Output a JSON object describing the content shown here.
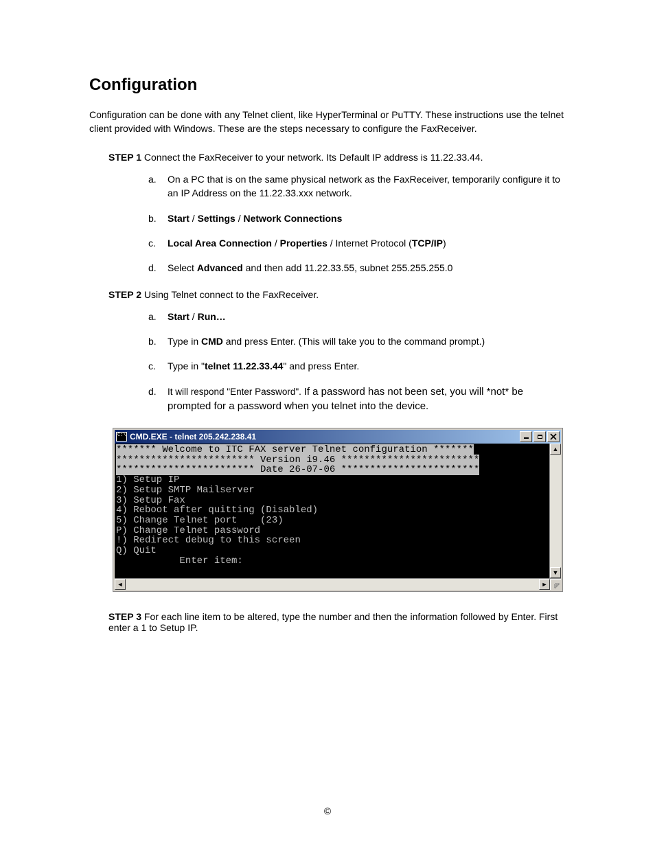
{
  "title": "Configuration",
  "intro": "Configuration can be done with any Telnet client, like HyperTerminal or PuTTY. These instructions use the telnet client provided with Windows. These are the steps necessary to configure the FaxReceiver.",
  "steps": {
    "s1": {
      "label": "STEP 1",
      "text": " Connect the FaxReceiver to your network. Its Default IP address is 11.22.33.44.",
      "a": "On a PC that is on the same physical network as the FaxReceiver, temporarily configure it to an IP Address on the 11.22.33.xxx network.",
      "b_parts": {
        "start": "Start",
        "sep1": " / ",
        "settings": "Settings",
        "sep2": " / ",
        "net": "Network Connections"
      },
      "c_parts": {
        "lac": "Local Area Connection",
        "sep1": " / ",
        "prop": "Properties",
        "sep2": " / Internet Protocol (",
        "tcp": "TCP/IP",
        "end": ")"
      },
      "d_parts": {
        "pre": "Select ",
        "adv": "Advanced",
        "post": " and then add 11.22.33.55, subnet 255.255.255.0"
      }
    },
    "s2": {
      "label": "STEP 2",
      "text": " Using Telnet connect to the FaxReceiver.",
      "a_parts": {
        "start": "Start",
        "sep": " / ",
        "run": "Run…"
      },
      "b_parts": {
        "pre": "Type in ",
        "cmd": "CMD",
        "post": " and press Enter. (This will take you to the command prompt.)"
      },
      "c_parts": {
        "pre": "Type in \"",
        "cmd": "telnet  11.22.33.44",
        "post": "\" and press Enter."
      },
      "d_parts": {
        "small": "It will respond \"Enter Password\". ",
        "big": "If a password has not been set, you will *not* be prompted for a password when you telnet into the device."
      }
    },
    "s3": {
      "label": "STEP 3",
      "text": " For each line item to be altered, type the number and then the information followed by Enter.  First enter a 1 to Setup IP."
    }
  },
  "terminal": {
    "title": "CMD.EXE - telnet 205.242.238.41",
    "header1": "******* Welcome to ITC FAX server Telnet configuration *******",
    "header2": "************************ Version i9.46 ************************",
    "header3": "************************ Date 26-07-06 ************************",
    "menu": [
      "1) Setup IP",
      "2) Setup SMTP Mailserver",
      "3) Setup Fax",
      "4) Reboot after quitting (Disabled)",
      "5) Change Telnet port    (23)",
      "P) Change Telnet password",
      "!) Redirect debug to this screen",
      "Q) Quit"
    ],
    "prompt": "           Enter item:"
  },
  "footer": "©"
}
